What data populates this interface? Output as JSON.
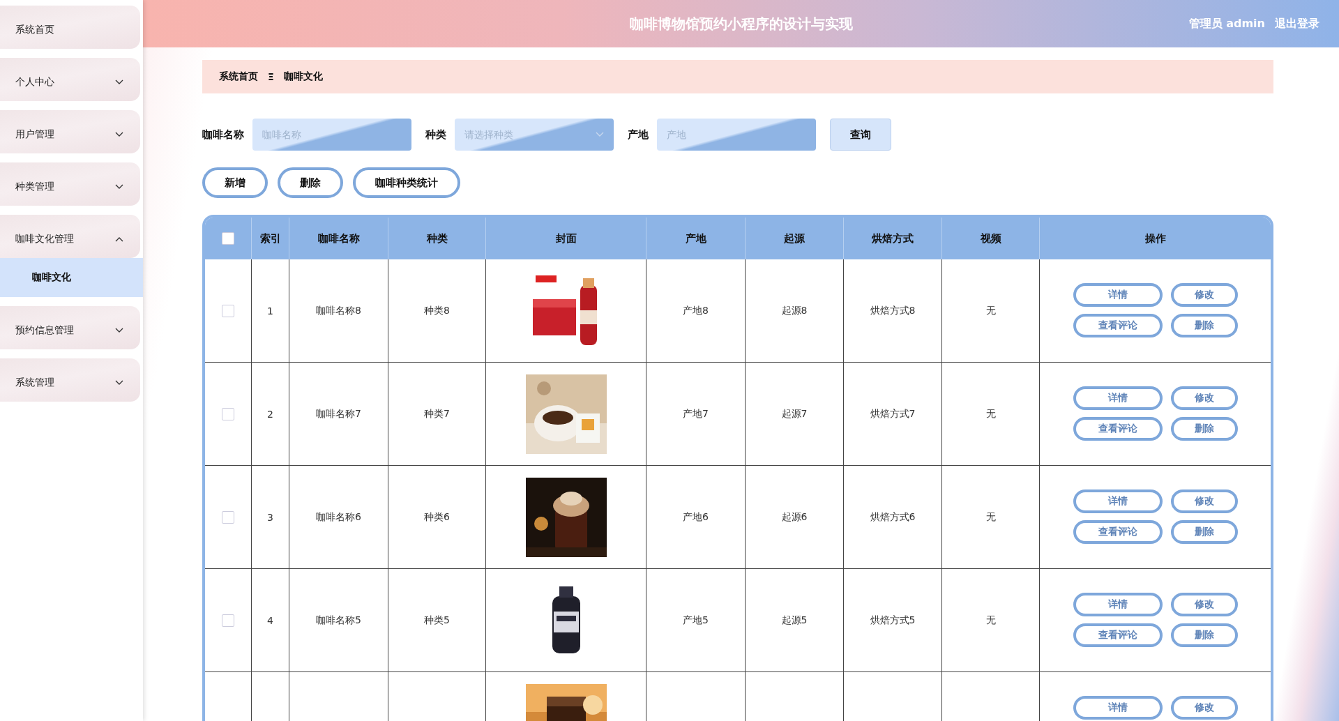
{
  "sidebar": {
    "items": [
      {
        "label": "系统首页",
        "kind": "link"
      },
      {
        "label": "个人中心",
        "kind": "menu",
        "expanded": false
      },
      {
        "label": "用户管理",
        "kind": "menu",
        "expanded": false
      },
      {
        "label": "种类管理",
        "kind": "menu",
        "expanded": false
      },
      {
        "label": "咖啡文化管理",
        "kind": "menu",
        "expanded": true,
        "children": [
          {
            "label": "咖啡文化",
            "selected": true
          }
        ]
      },
      {
        "label": "预约信息管理",
        "kind": "menu",
        "expanded": false
      },
      {
        "label": "系统管理",
        "kind": "menu",
        "expanded": false
      }
    ]
  },
  "header": {
    "title": "咖啡博物馆预约小程序的设计与实现",
    "user": "管理员 admin",
    "logout": "退出登录"
  },
  "breadcrumb": {
    "items": [
      "系统首页",
      "咖啡文化"
    ],
    "separator": "Ξ"
  },
  "search": {
    "fields": [
      {
        "label": "咖啡名称",
        "placeholder": "咖啡名称",
        "kind": "text"
      },
      {
        "label": "种类",
        "placeholder": "请选择种类",
        "kind": "select"
      },
      {
        "label": "产地",
        "placeholder": "产地",
        "kind": "text"
      }
    ],
    "button": "查询"
  },
  "toolbar": [
    "新增",
    "删除",
    "咖啡种类统计"
  ],
  "table": {
    "header_checked": false,
    "columns": [
      "索引",
      "咖啡名称",
      "种类",
      "封面",
      "产地",
      "起源",
      "烘焙方式",
      "视频",
      "操作"
    ],
    "rows": [
      {
        "checked": false,
        "cells": [
          "1",
          "咖啡名称8",
          "种类8"
        ],
        "cover": {
          "kind": "picture"
        },
        "cells_after": [
          "产地8",
          "起源8",
          "烘焙方式8",
          "无"
        ],
        "actions": [
          "详情",
          "修改",
          "查看评论",
          "删除"
        ]
      },
      {
        "checked": false,
        "cells": [
          "2",
          "咖啡名称7",
          "种类7"
        ],
        "cover": {
          "kind": "picture"
        },
        "cells_after": [
          "产地7",
          "起源7",
          "烘焙方式7",
          "无"
        ],
        "actions": [
          "详情",
          "修改",
          "查看评论",
          "删除"
        ]
      },
      {
        "checked": false,
        "cells": [
          "3",
          "咖啡名称6",
          "种类6"
        ],
        "cover": {
          "kind": "picture"
        },
        "cells_after": [
          "产地6",
          "起源6",
          "烘焙方式6",
          "无"
        ],
        "actions": [
          "详情",
          "修改",
          "查看评论",
          "删除"
        ]
      },
      {
        "checked": false,
        "cells": [
          "4",
          "咖啡名称5",
          "种类5"
        ],
        "cover": {
          "kind": "picture"
        },
        "cells_after": [
          "产地5",
          "起源5",
          "烘焙方式5",
          "无"
        ],
        "actions": [
          "详情",
          "修改",
          "查看评论",
          "删除"
        ]
      },
      {
        "cover": {
          "kind": "picture"
        },
        "actions": [
          "详情",
          "修改"
        ]
      }
    ]
  }
}
